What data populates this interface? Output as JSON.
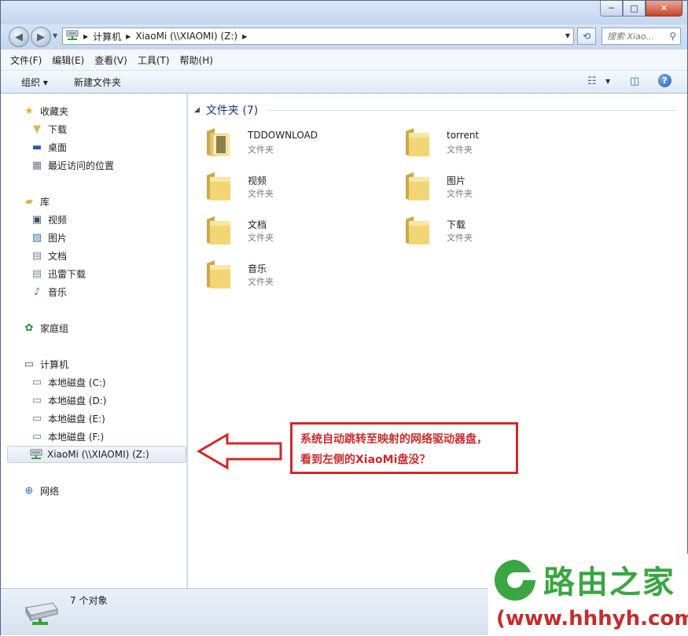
{
  "window": {
    "title_buttons": {
      "minimize": "─",
      "maximize": "□",
      "close": "✕"
    }
  },
  "address": {
    "segments": [
      "计算机",
      "XiaoMi (\\\\XIAOMI) (Z:)"
    ],
    "search_placeholder": "搜索 Xiao..."
  },
  "menubar": {
    "items": [
      "文件(F)",
      "编辑(E)",
      "查看(V)",
      "工具(T)",
      "帮助(H)"
    ]
  },
  "toolbar": {
    "organize_label": "组织 ▾",
    "new_folder_label": "新建文件夹"
  },
  "sidebar": {
    "favorites": {
      "label": "收藏夹",
      "items": [
        "下载",
        "桌面",
        "最近访问的位置"
      ]
    },
    "libraries": {
      "label": "库",
      "items": [
        "视频",
        "图片",
        "文档",
        "迅雷下载",
        "音乐"
      ]
    },
    "homegroup": {
      "label": "家庭组"
    },
    "computer": {
      "label": "计算机",
      "items": [
        "本地磁盘 (C:)",
        "本地磁盘 (D:)",
        "本地磁盘 (E:)",
        "本地磁盘 (F:)",
        "XiaoMi (\\\\XIAOMI) (Z:)"
      ]
    },
    "network": {
      "label": "网络"
    }
  },
  "content": {
    "group_header": "文件夹 (7)",
    "folders": [
      {
        "name": "TDDOWNLOAD",
        "type": "文件夹"
      },
      {
        "name": "torrent",
        "type": "文件夹"
      },
      {
        "name": "视频",
        "type": "文件夹"
      },
      {
        "name": "图片",
        "type": "文件夹"
      },
      {
        "name": "文档",
        "type": "文件夹"
      },
      {
        "name": "下载",
        "type": "文件夹"
      },
      {
        "name": "音乐",
        "type": "文件夹"
      }
    ]
  },
  "status": {
    "count_text": "7 个对象"
  },
  "annotation": {
    "line1": "系统自动跳转至映射的网络驱动器盘，",
    "line2": "看到左侧的XiaoMi盘没？",
    "color": "#cc2b2b"
  },
  "watermark": {
    "logo_text": "路由之家",
    "url": "(www.hhhyh.com)",
    "logo_color": "#39a641",
    "url_color": "#c32d2d"
  }
}
